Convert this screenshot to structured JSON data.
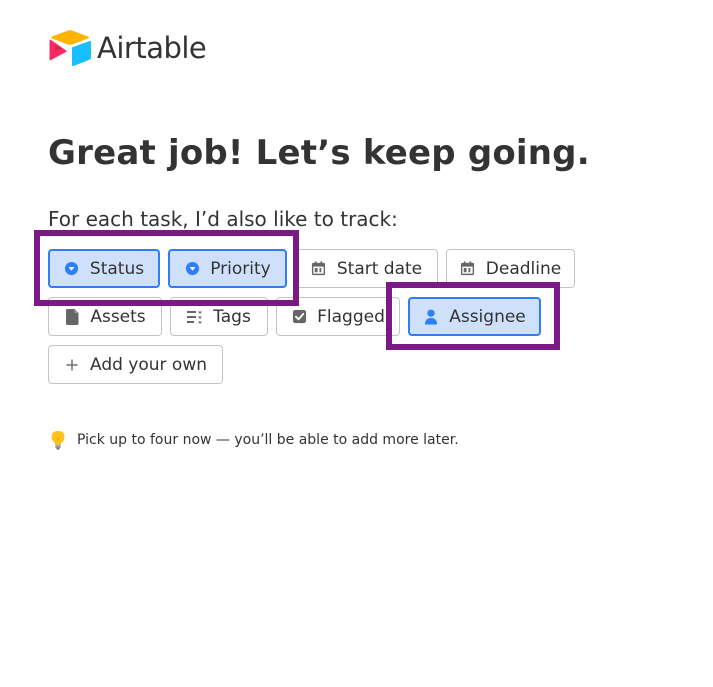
{
  "brand": {
    "name": "Airtable",
    "logo_icon": "airtable-logo-icon",
    "colors": {
      "yellow": "#fcb400",
      "blue": "#18bfff",
      "red": "#f82b60"
    }
  },
  "title": "Great job! Let’s keep going.",
  "subtitle": "For each task, I’d also like to track:",
  "options": [
    {
      "label": "Status",
      "icon": "single-select-icon",
      "selected": true
    },
    {
      "label": "Priority",
      "icon": "single-select-icon",
      "selected": true
    },
    {
      "label": "Start date",
      "icon": "calendar-icon",
      "selected": false
    },
    {
      "label": "Deadline",
      "icon": "calendar-icon",
      "selected": false
    },
    {
      "label": "Assets",
      "icon": "document-icon",
      "selected": false
    },
    {
      "label": "Tags",
      "icon": "multi-select-icon",
      "selected": false
    },
    {
      "label": "Flagged",
      "icon": "checkbox-icon",
      "selected": false
    },
    {
      "label": "Assignee",
      "icon": "person-icon",
      "selected": true
    },
    {
      "label": "Add your own",
      "icon": "plus-icon",
      "selected": false
    }
  ],
  "tip": {
    "icon": "lightbulb-icon",
    "text": "Pick up to four now — you’ll be able to add more later."
  },
  "colors": {
    "selected_bg": "#cfe0fc",
    "selected_border": "#2d7ff9",
    "annotation_highlight": "#7b1a85"
  }
}
